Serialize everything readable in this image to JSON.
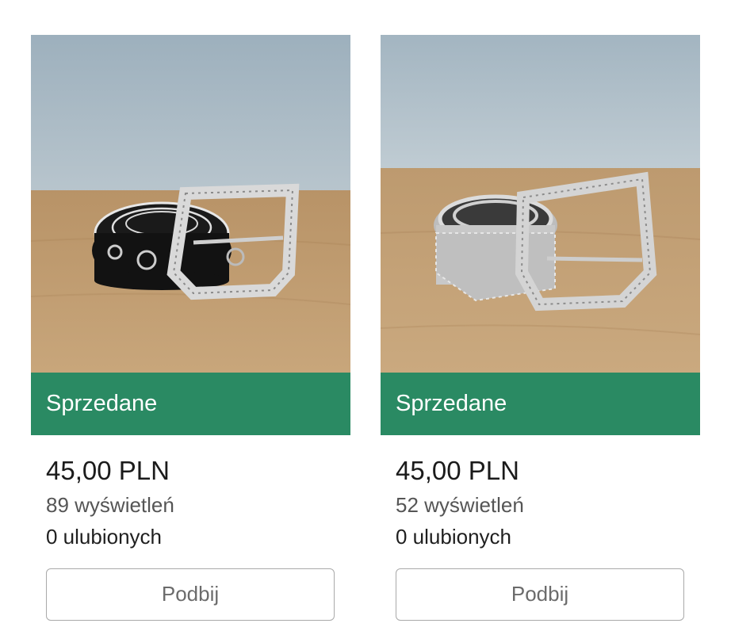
{
  "items": [
    {
      "photo_icon": "black-belt-with-studded-silver-buckle",
      "status_label": "Sprzedane",
      "price": "45,00 PLN",
      "views": "89 wyświetleń",
      "favourites": "0 ulubionych",
      "bump_label": "Podbij"
    },
    {
      "photo_icon": "silver-studded-belt",
      "status_label": "Sprzedane",
      "price": "45,00 PLN",
      "views": "52 wyświetleń",
      "favourites": "0 ulubionych",
      "bump_label": "Podbij"
    }
  ],
  "colors": {
    "sold_banner": "#2a8a63",
    "wall": "#a9bac5",
    "wood": "#c09a6c"
  }
}
